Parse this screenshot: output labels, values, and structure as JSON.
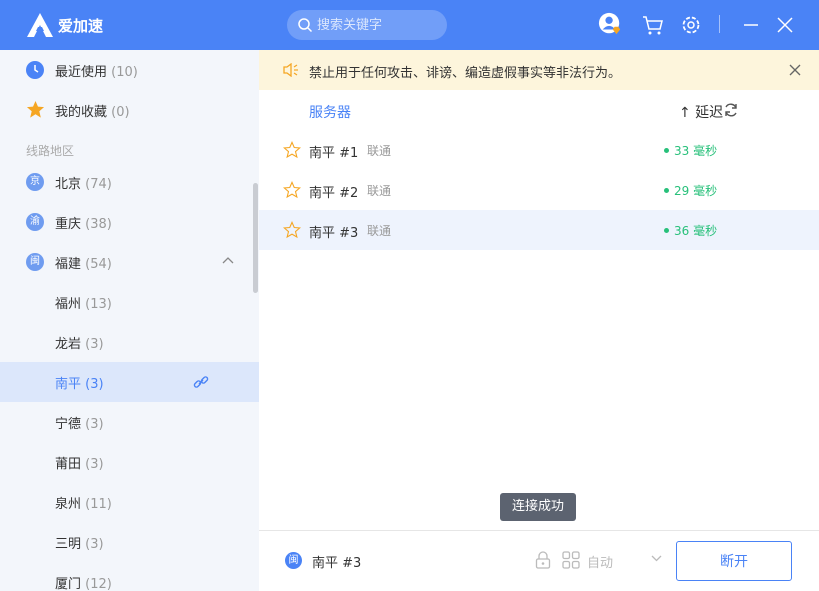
{
  "app": {
    "name": "爱加速"
  },
  "search": {
    "placeholder": "搜索关键字"
  },
  "colors": {
    "accent": "#4a83f6",
    "latency_good": "#27c07a",
    "star": "#f5a623"
  },
  "sidebar": {
    "recent": {
      "label": "最近使用",
      "count": "(10)"
    },
    "favorites": {
      "label": "我的收藏",
      "count": "(0)"
    },
    "section_title": "线路地区",
    "regions": [
      {
        "badge": "京",
        "label": "北京",
        "count": "(74)"
      },
      {
        "badge": "渝",
        "label": "重庆",
        "count": "(38)"
      },
      {
        "badge": "闽",
        "label": "福建",
        "count": "(54)"
      }
    ],
    "cities": [
      {
        "label": "福州",
        "count": "(13)"
      },
      {
        "label": "龙岩",
        "count": "(3)"
      },
      {
        "label": "南平",
        "count": "(3)"
      },
      {
        "label": "宁德",
        "count": "(3)"
      },
      {
        "label": "莆田",
        "count": "(3)"
      },
      {
        "label": "泉州",
        "count": "(11)"
      },
      {
        "label": "三明",
        "count": "(3)"
      },
      {
        "label": "厦门",
        "count": "(12)"
      }
    ]
  },
  "notice": {
    "text": "禁止用于任何攻击、诽谤、编造虚假事实等非法行为。"
  },
  "table": {
    "col_server": "服务器",
    "col_latency": "↑ 延迟",
    "rows": [
      {
        "name": "南平 #1",
        "isp": "联通",
        "latency": "33 毫秒"
      },
      {
        "name": "南平 #2",
        "isp": "联通",
        "latency": "29 毫秒"
      },
      {
        "name": "南平 #3",
        "isp": "联通",
        "latency": "36 毫秒"
      }
    ]
  },
  "toast": "连接成功",
  "footer": {
    "badge": "闽",
    "current": "南平 #3",
    "mode": "自动",
    "disconnect": "断开"
  }
}
